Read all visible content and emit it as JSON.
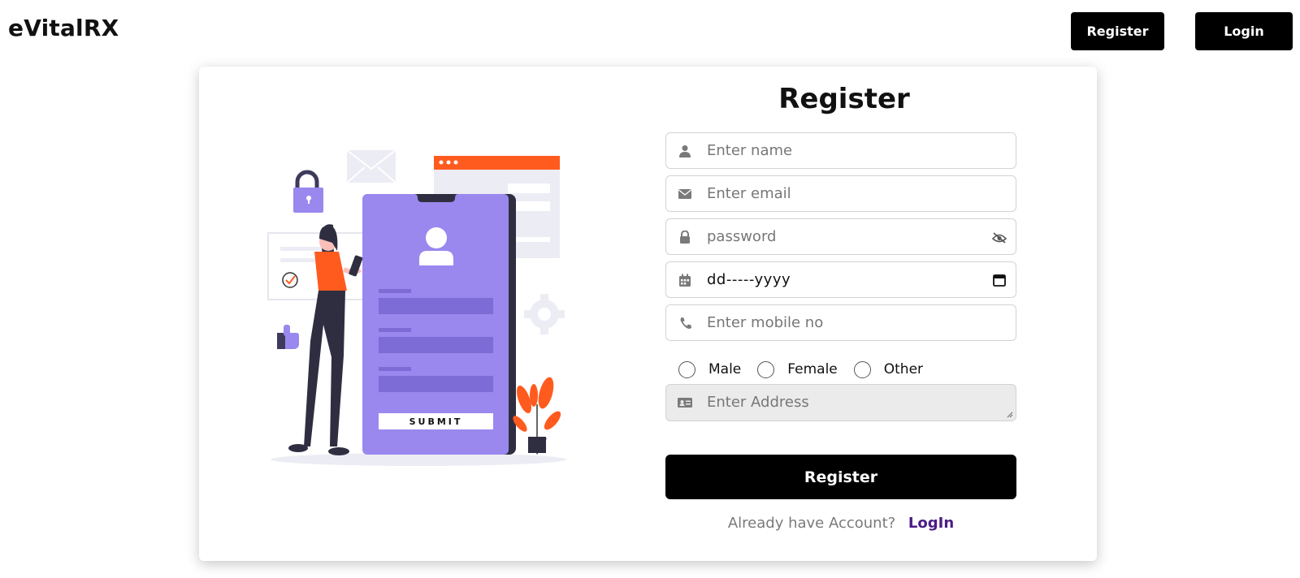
{
  "header": {
    "brand": "eVitalRX",
    "register_label": "Register",
    "login_label": "Login"
  },
  "illustration": {
    "submit_label": "SUBMIT"
  },
  "form": {
    "title": "Register",
    "name_placeholder": "Enter name",
    "email_placeholder": "Enter email",
    "password_placeholder": "password",
    "dob_value": "dd-----yyyy",
    "mobile_placeholder": "Enter mobile no",
    "gender_options": [
      "Male",
      "Female",
      "Other"
    ],
    "address_placeholder": "Enter Address",
    "submit_label": "Register",
    "account_text": "Already have Account?",
    "account_link": "LogIn"
  },
  "colors": {
    "accent_purple": "#9a88ee",
    "accent_orange": "#ff5b1f",
    "link": "#4b1c84",
    "button": "#000000"
  },
  "icons": {
    "name": "user-icon",
    "email": "envelope-icon",
    "password": "lock-icon",
    "password_toggle": "eye-slash-icon",
    "dob": "calendar-icon",
    "mobile": "phone-icon",
    "address": "id-card-icon"
  }
}
